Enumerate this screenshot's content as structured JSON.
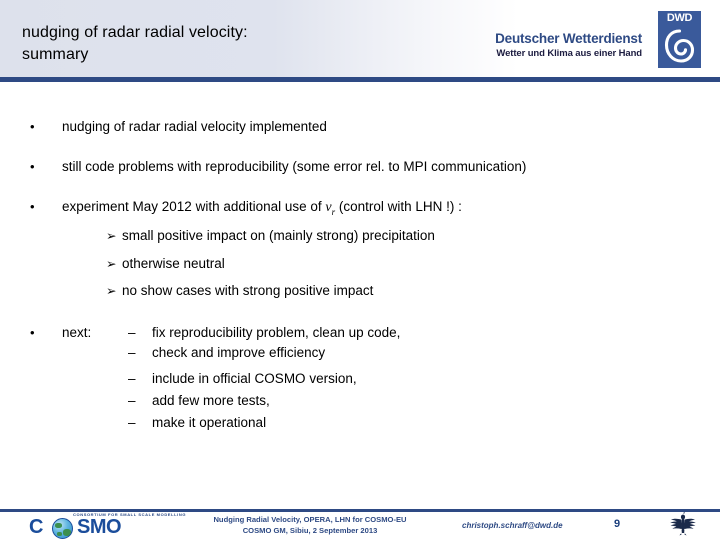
{
  "slide": {
    "title_line1": "nudging of radar radial velocity:",
    "title_line2": "summary",
    "page_number": "9"
  },
  "dwd_logo": {
    "name": "Deutscher Wetterdienst",
    "tagline": "Wetter und Klima aus einer Hand",
    "box_text": "DWD"
  },
  "body": {
    "bullets": [
      {
        "marker": "•",
        "text": "nudging of radar radial velocity implemented"
      },
      {
        "marker": "•",
        "text": "still code problems with reproducibility  (some error rel. to MPI communication)"
      },
      {
        "marker": "•",
        "text_before_var": "experiment May 2012 with additional use of ",
        "var_symbol": "v",
        "var_subscript": "r",
        "text_after_var": "  (control with LHN !) :"
      },
      {
        "marker": "•",
        "text": "next:"
      }
    ],
    "sub_arrows": [
      {
        "marker": "➢",
        "text": "small positive impact on (mainly strong) precipitation"
      },
      {
        "marker": "➢",
        "text": "otherwise neutral"
      },
      {
        "marker": "➢",
        "text": "no show cases with strong positive impact"
      }
    ],
    "dash_items": [
      {
        "marker": "–",
        "text": "fix reproducibility problem, clean up code,"
      },
      {
        "marker": "–",
        "text": "check and improve efficiency"
      },
      {
        "marker": "–",
        "text": "include in official COSMO version,"
      },
      {
        "marker": "–",
        "text": "add few more tests,"
      },
      {
        "marker": "–",
        "text": "make it operational"
      }
    ]
  },
  "footer": {
    "cosmo_tiny_text": "CONSORTIUM FOR SMALL SCALE MODELLING",
    "cosmo_left": "C",
    "cosmo_right": "SMO",
    "line1": "Nudging Radial Velocity, OPERA, LHN for COSMO-EU",
    "line2": "COSMO GM, Sibiu, 2 September 2013",
    "email": "christoph.schraff@dwd.de",
    "page": "9"
  },
  "colors": {
    "accent_blue": "#2e4a84",
    "dwd_box": "#3a5a9b",
    "cosmo_blue": "#1b4d9b",
    "header_bg": "#dde1ec"
  }
}
